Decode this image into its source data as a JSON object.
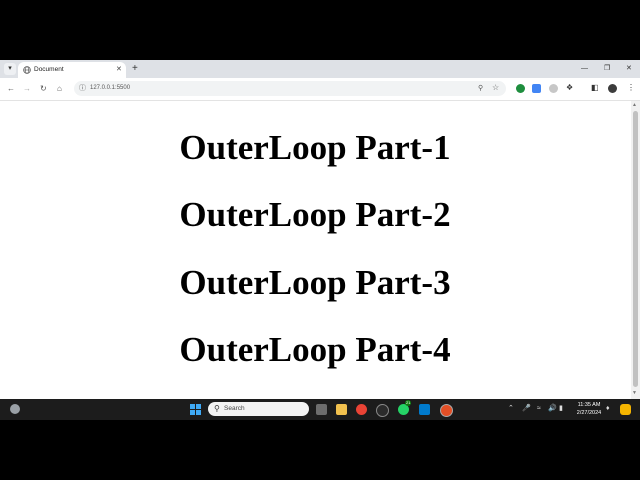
{
  "browser": {
    "tab": {
      "title": "Document"
    },
    "url": "127.0.0.1:5500"
  },
  "page": {
    "headings": [
      "OuterLoop Part-1",
      "OuterLoop Part-2",
      "OuterLoop Part-3",
      "OuterLoop Part-4"
    ]
  },
  "taskbar": {
    "search_placeholder": "Search",
    "time": "11:35 AM",
    "date": "2/27/2024",
    "whatsapp_badge": "21"
  },
  "colors": {
    "tabstrip_bg": "#dee1e6",
    "taskbar_bg": "#1c1c1c",
    "heading_color": "#000000"
  }
}
